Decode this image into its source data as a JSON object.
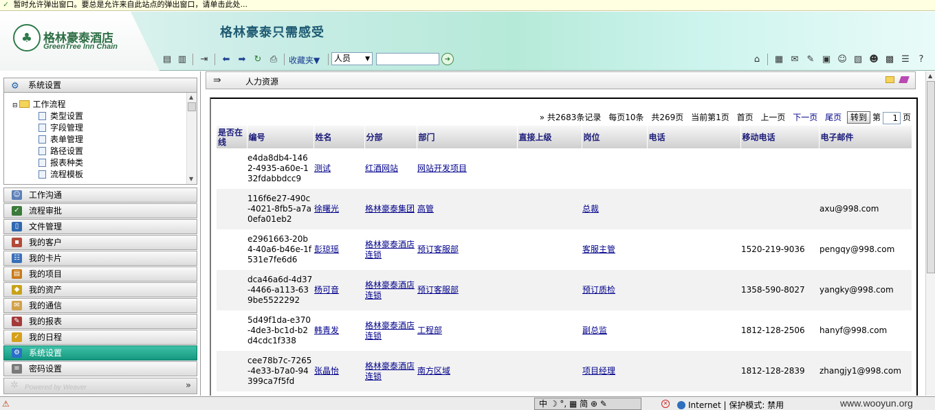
{
  "infobar": {
    "text": "暂时允许弹出窗口。要总是允许来自此站点的弹出窗口，请单击此处..."
  },
  "header": {
    "logo_cn": "格林豪泰酒店",
    "logo_en": "GreenTree Inn Chain",
    "slogan": "格林豪泰只需感受",
    "favorites_label": "收藏夹▼",
    "person_select": "人员",
    "search_value": ""
  },
  "sidebar": {
    "top_section": "系统设置",
    "tree": [
      {
        "label": "工作流程",
        "type": "folder"
      },
      {
        "label": "类型设置",
        "type": "doc"
      },
      {
        "label": "字段管理",
        "type": "doc"
      },
      {
        "label": "表单管理",
        "type": "doc"
      },
      {
        "label": "路径设置",
        "type": "doc"
      },
      {
        "label": "报表种类",
        "type": "doc"
      },
      {
        "label": "流程模板",
        "type": "doc"
      }
    ],
    "items": [
      {
        "label": "工作沟通",
        "color": "#5b7fb7"
      },
      {
        "label": "流程审批",
        "color": "#3a7a3a"
      },
      {
        "label": "文件管理",
        "color": "#2f68b0"
      },
      {
        "label": "我的客户",
        "color": "#b34a3a"
      },
      {
        "label": "我的卡片",
        "color": "#3a6fb8"
      },
      {
        "label": "我的项目",
        "color": "#c87a1a"
      },
      {
        "label": "我的资产",
        "color": "#c8a21a"
      },
      {
        "label": "我的通信",
        "color": "#d2a24a"
      },
      {
        "label": "我的报表",
        "color": "#a43a3a"
      },
      {
        "label": "我的日程",
        "color": "#d6a01a"
      },
      {
        "label": "系统设置",
        "color": "#2a6fc8",
        "active": true
      },
      {
        "label": "密码设置",
        "color": "#7a7a7a"
      }
    ],
    "powered_by": "Powered by Weaver",
    "more_symbol": "»"
  },
  "content": {
    "title": "人力资源",
    "pager": {
      "total": "» 共2683条记录",
      "per_page": "每页10条",
      "pages": "共269页",
      "current": "当前第1页",
      "first": "首页",
      "prev": "上一页",
      "next": "下一页",
      "last": "尾页",
      "goto": "转到",
      "page_prefix": "第",
      "page_value": "1",
      "page_suffix": "页"
    },
    "columns": [
      "是否在线",
      "编号",
      "姓名",
      "分部",
      "部门",
      "直接上级",
      "岗位",
      "电话",
      "移动电话",
      "电子邮件"
    ],
    "rows": [
      [
        "",
        "e4da8db4-1462-4935-a60e-132fdabbdcc9",
        "测试",
        "红酒网站",
        "网站开发项目",
        "",
        "",
        "",
        "",
        ""
      ],
      [
        "",
        "116f6e27-490c-4021-8fb5-a7a0efa01eb2",
        "徐曙光",
        "格林豪泰集团",
        "高管",
        "",
        "总裁",
        "",
        "",
        "axu@998.com"
      ],
      [
        "",
        "e2961663-20b4-40a6-b46e-1f531e7fe6d6",
        "彭琼瑶",
        "格林豪泰酒店连锁",
        "预订客服部",
        "",
        "客服主管",
        "",
        "1520-219-9036",
        "pengqy@998.com"
      ],
      [
        "",
        "dca46a6d-4d37-4466-a113-639be5522292",
        "杨可音",
        "格林豪泰酒店连锁",
        "预订客服部",
        "",
        "预订质检",
        "",
        "1358-590-8027",
        "yangky@998.com"
      ],
      [
        "",
        "5d49f1da-e370-4de3-bc1d-b2d4cdc1f338",
        "韩青发",
        "格林豪泰酒店连锁",
        "工程部",
        "",
        "副总监",
        "",
        "1812-128-2506",
        "hanyf@998.com"
      ],
      [
        "",
        "cee78b7c-7265-4e33-b7a0-94399ca7f5fd",
        "张晶怡",
        "格林豪泰酒店连锁",
        "南方区域",
        "",
        "项目经理",
        "",
        "1812-128-2839",
        "zhangjy1@998.com"
      ]
    ]
  },
  "statusbar": {
    "ime": "中 ☽ °, ▦ 简 ⊕ ✎",
    "zone": "Internet | 保护模式: 禁用",
    "watermark": "www.wooyun.org"
  },
  "colors": {
    "accent": "#14977f",
    "link": "#00008b"
  }
}
